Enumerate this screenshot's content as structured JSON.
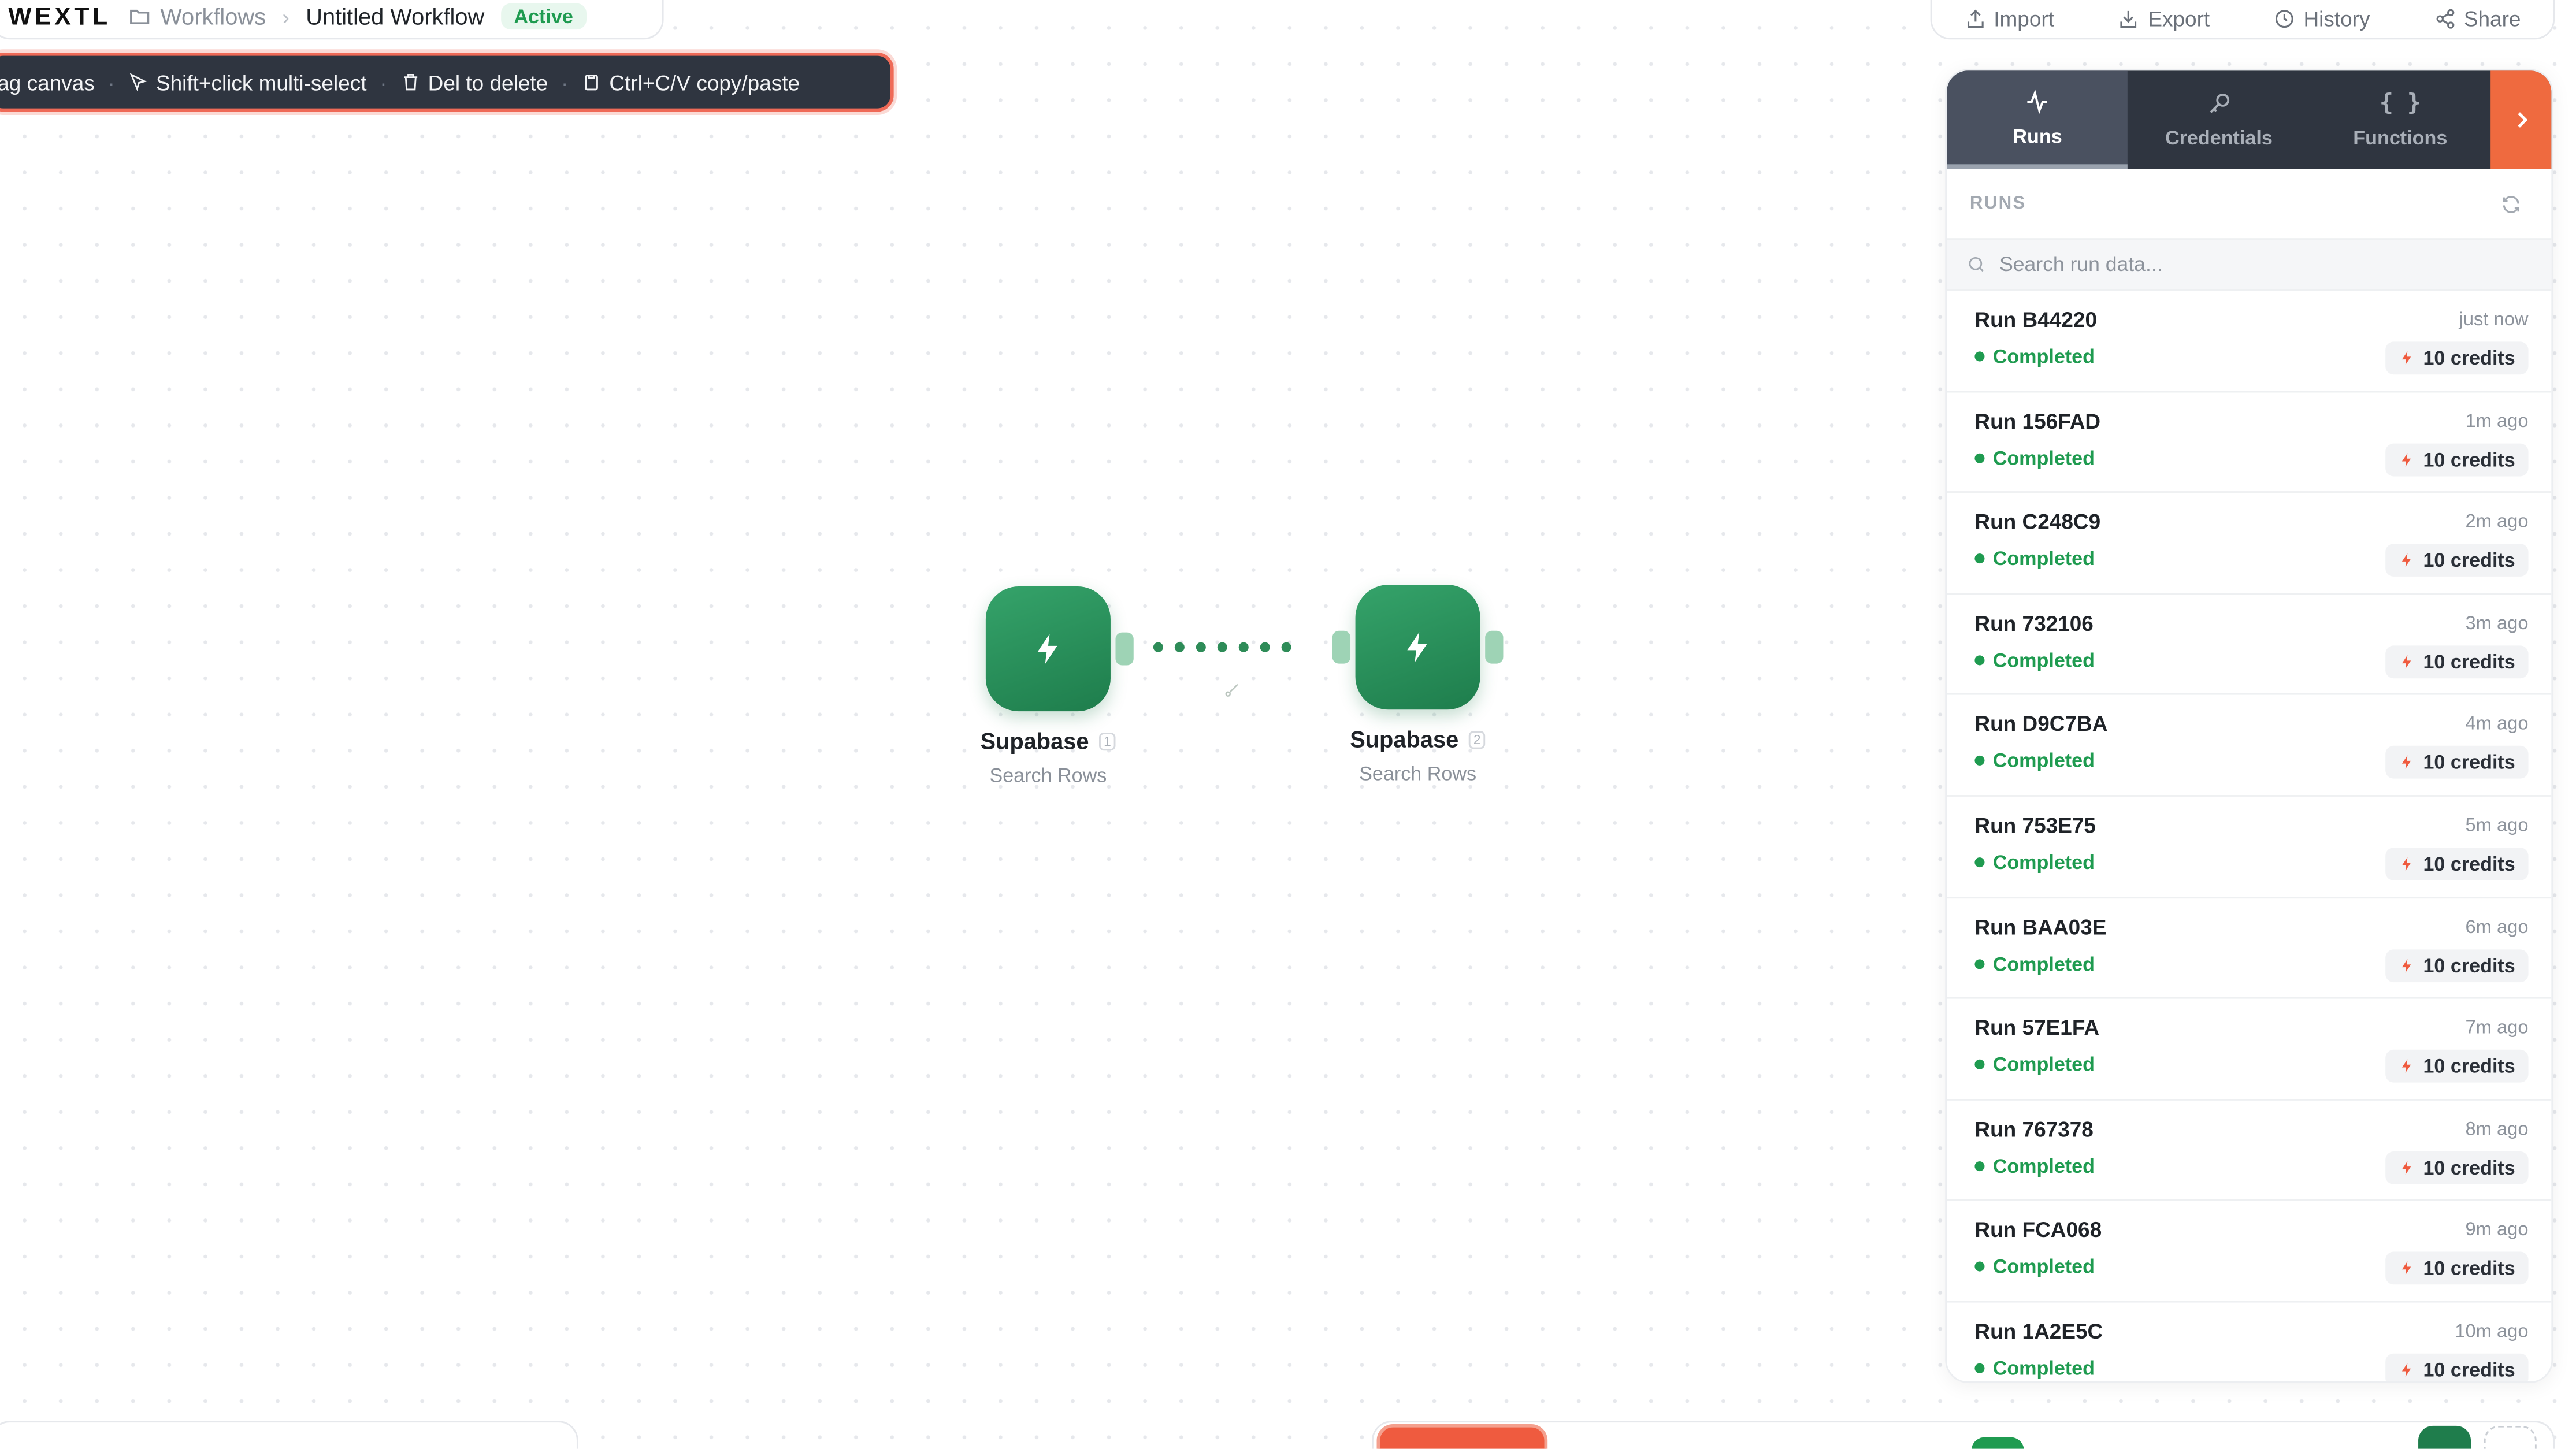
{
  "app": {
    "logo": "WEXTL",
    "breadcrumb_root": "Workflows",
    "workflow_title": "Untitled Workflow",
    "status_badge": "Active"
  },
  "hints": [
    "rag canvas",
    "Shift+click multi-select",
    "Del to delete",
    "Ctrl+C/V copy/paste"
  ],
  "toolbar": {
    "import": "Import",
    "export": "Export",
    "history": "History",
    "share": "Share"
  },
  "nodes": [
    {
      "title": "Supabase",
      "index": "1",
      "subtitle": "Search Rows"
    },
    {
      "title": "Supabase",
      "index": "2",
      "subtitle": "Search Rows"
    }
  ],
  "panel": {
    "tabs": [
      {
        "label": "Runs",
        "icon": "activity-icon",
        "active": true
      },
      {
        "label": "Credentials",
        "icon": "key-icon",
        "active": false
      },
      {
        "label": "Functions",
        "icon": "braces-icon",
        "active": false
      }
    ],
    "runs_label": "RUNS",
    "search_placeholder": "Search run data...",
    "runs": [
      {
        "name": "Run B44220",
        "time": "just now",
        "status": "Completed",
        "credits": "10 credits"
      },
      {
        "name": "Run 156FAD",
        "time": "1m ago",
        "status": "Completed",
        "credits": "10 credits"
      },
      {
        "name": "Run C248C9",
        "time": "2m ago",
        "status": "Completed",
        "credits": "10 credits"
      },
      {
        "name": "Run 732106",
        "time": "3m ago",
        "status": "Completed",
        "credits": "10 credits"
      },
      {
        "name": "Run D9C7BA",
        "time": "4m ago",
        "status": "Completed",
        "credits": "10 credits"
      },
      {
        "name": "Run 753E75",
        "time": "5m ago",
        "status": "Completed",
        "credits": "10 credits"
      },
      {
        "name": "Run BAA03E",
        "time": "6m ago",
        "status": "Completed",
        "credits": "10 credits"
      },
      {
        "name": "Run 57E1FA",
        "time": "7m ago",
        "status": "Completed",
        "credits": "10 credits"
      },
      {
        "name": "Run 767378",
        "time": "8m ago",
        "status": "Completed",
        "credits": "10 credits"
      },
      {
        "name": "Run FCA068",
        "time": "9m ago",
        "status": "Completed",
        "credits": "10 credits"
      },
      {
        "name": "Run 1A2E5C",
        "time": "10m ago",
        "status": "Completed",
        "credits": "10 credits"
      }
    ]
  },
  "colors": {
    "accent": "#ef6a3f",
    "node_green": "#2e8c58",
    "status_green": "#1f9b50",
    "panel_dark": "#2f3540"
  }
}
